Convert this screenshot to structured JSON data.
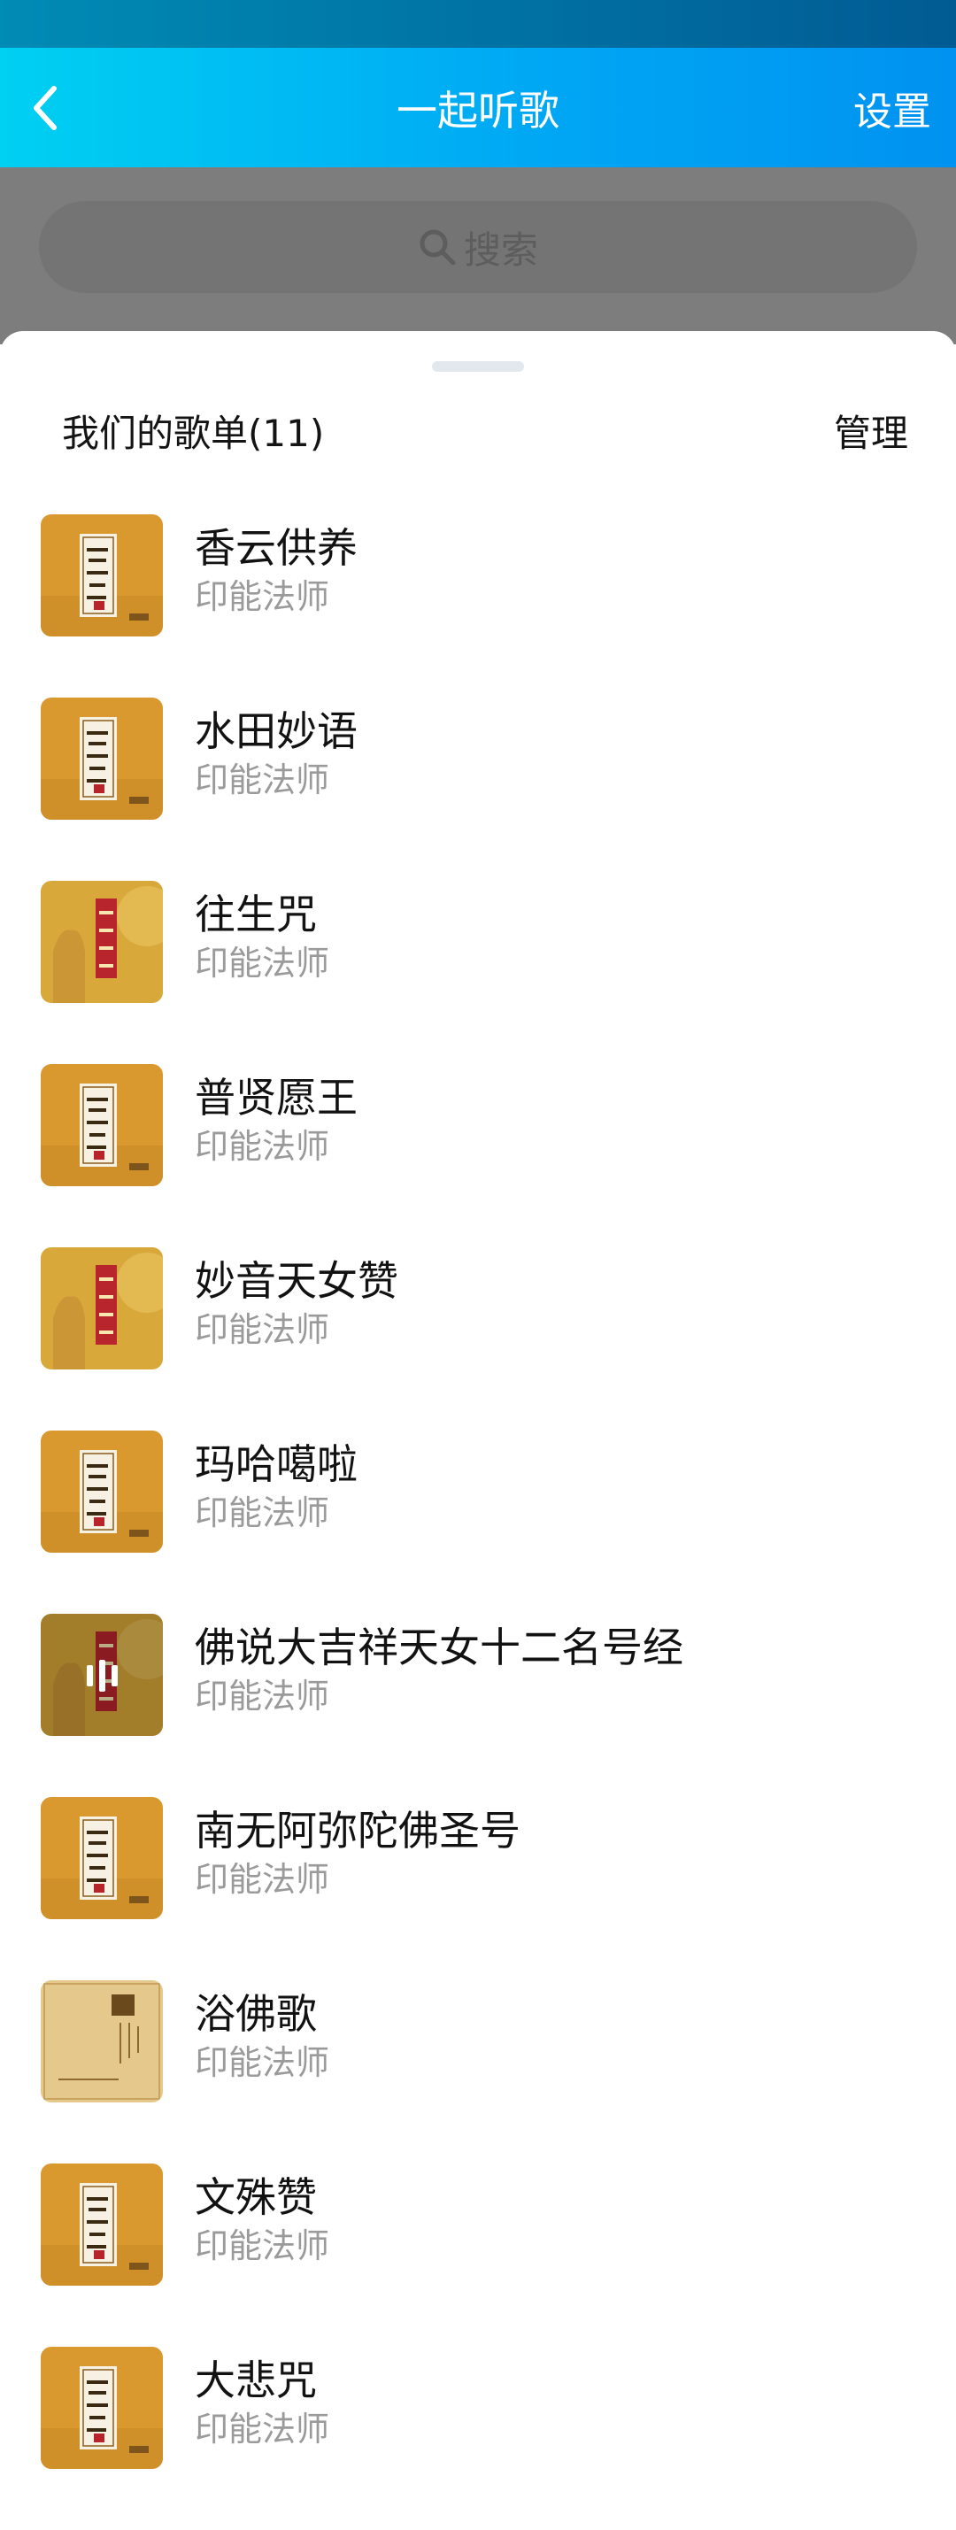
{
  "nav": {
    "title": "一起听歌",
    "back_icon": "chevron-left-icon",
    "settings_label": "设置"
  },
  "search": {
    "placeholder": "搜索",
    "icon": "search-icon"
  },
  "playlist": {
    "title": "我们的歌单(11)",
    "manage_label": "管理"
  },
  "colors": {
    "nav_start": "#00d0f2",
    "nav_end": "#0092f0",
    "overlay": "#7d7d7d",
    "artist_text": "#9a9a9a"
  },
  "songs": [
    {
      "title": "香云供养",
      "artist": "印能法师",
      "cover": "a",
      "playing": false
    },
    {
      "title": "水田妙语",
      "artist": "印能法师",
      "cover": "a",
      "playing": false
    },
    {
      "title": "往生咒",
      "artist": "印能法师",
      "cover": "b",
      "playing": false
    },
    {
      "title": "普贤愿王",
      "artist": "印能法师",
      "cover": "a",
      "playing": false
    },
    {
      "title": "妙音天女赞",
      "artist": "印能法师",
      "cover": "b",
      "playing": false
    },
    {
      "title": "玛哈噶啦",
      "artist": "印能法师",
      "cover": "a",
      "playing": false
    },
    {
      "title": "佛说大吉祥天女十二名号经",
      "artist": "印能法师",
      "cover": "b",
      "playing": true
    },
    {
      "title": "南无阿弥陀佛圣号",
      "artist": "印能法师",
      "cover": "a",
      "playing": false
    },
    {
      "title": "浴佛歌",
      "artist": "印能法师",
      "cover": "c",
      "playing": false
    },
    {
      "title": "文殊赞",
      "artist": "印能法师",
      "cover": "a",
      "playing": false
    },
    {
      "title": "大悲咒",
      "artist": "印能法师",
      "cover": "a",
      "playing": false
    }
  ]
}
